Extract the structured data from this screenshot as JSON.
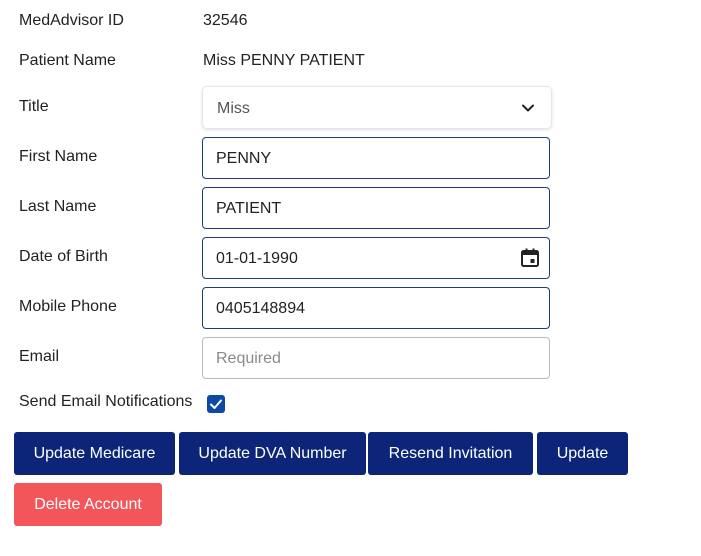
{
  "fields": {
    "medadvisor_id": {
      "label": "MedAdvisor ID",
      "value": "32546"
    },
    "patient_name": {
      "label": "Patient Name",
      "value": "Miss PENNY PATIENT"
    },
    "title": {
      "label": "Title",
      "value": "Miss"
    },
    "first_name": {
      "label": "First Name",
      "value": "PENNY"
    },
    "last_name": {
      "label": "Last Name",
      "value": "PATIENT"
    },
    "date_of_birth": {
      "label": "Date of Birth",
      "value": "01-01-1990"
    },
    "mobile_phone": {
      "label": "Mobile Phone",
      "value": "0405148894"
    },
    "email": {
      "label": "Email",
      "value": "",
      "placeholder": "Required"
    },
    "send_email_notifications": {
      "label": "Send Email Notifications",
      "checked": true
    }
  },
  "buttons": {
    "update_medicare": "Update Medicare",
    "update_dva": "Update DVA Number",
    "resend_invitation": "Resend Invitation",
    "update": "Update",
    "delete_account": "Delete Account"
  },
  "icons": {
    "title_dropdown": "chevron-down-icon",
    "date_picker": "calendar-icon",
    "checkbox": "check-icon"
  },
  "colors": {
    "primary_button": "#0c2578",
    "danger_button": "#f2555a",
    "input_border_active": "#1f3f7a",
    "checkbox": "#0e4aa3"
  }
}
